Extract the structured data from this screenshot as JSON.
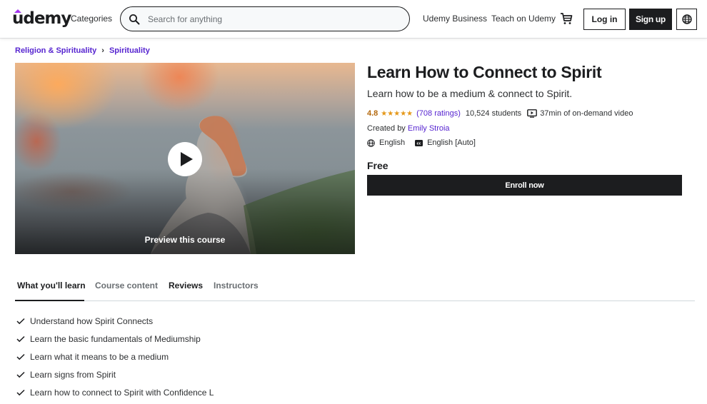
{
  "header": {
    "logo": "udemy",
    "categories_label": "Categories",
    "search": {
      "placeholder": "Search for anything",
      "value": ""
    },
    "udemy_business_label": "Udemy Business",
    "teach_label": "Teach on Udemy",
    "login_label": "Log in",
    "signup_label": "Sign up",
    "icons": {
      "search": "search-icon",
      "cart": "cart-icon",
      "language": "globe-icon"
    }
  },
  "breadcrumb": [
    {
      "label": "Religion & Spirituality"
    },
    {
      "label": "Spirituality"
    }
  ],
  "preview": {
    "label": "Preview this course",
    "icon": "play-icon"
  },
  "course": {
    "title": "Learn How to Connect to Spirit",
    "subtitle": "Learn how to be a medium & connect to Spirit.",
    "rating": "4.8",
    "rating_value": 4.8,
    "stars": "★★★★★",
    "ratings_count": "(708 ratings)",
    "students": "10,524 students",
    "video_length": "37min of on-demand video",
    "created_by_label": "Created by",
    "instructor": "Emily Stroia",
    "language": "English",
    "captions": "English [Auto]",
    "price": "Free",
    "enroll_label": "Enroll now"
  },
  "tabs": [
    {
      "label": "What you'll learn",
      "active": true
    },
    {
      "label": "Course content",
      "active": false
    },
    {
      "label": "Reviews",
      "active": false
    },
    {
      "label": "Instructors",
      "active": false
    }
  ],
  "learn_items": [
    "Understand how Spirit Connects",
    "Learn the basic fundamentals of Mediumship",
    "Learn what it means to be a medium",
    "Learn signs from Spirit",
    "Learn how to connect to Spirit with Confidence L"
  ],
  "colors": {
    "brand_purple": "#a435f0",
    "link_purple": "#5624d0",
    "rating_orange": "#b4690e",
    "star_orange": "#e59819",
    "dark": "#1c1d1f"
  }
}
